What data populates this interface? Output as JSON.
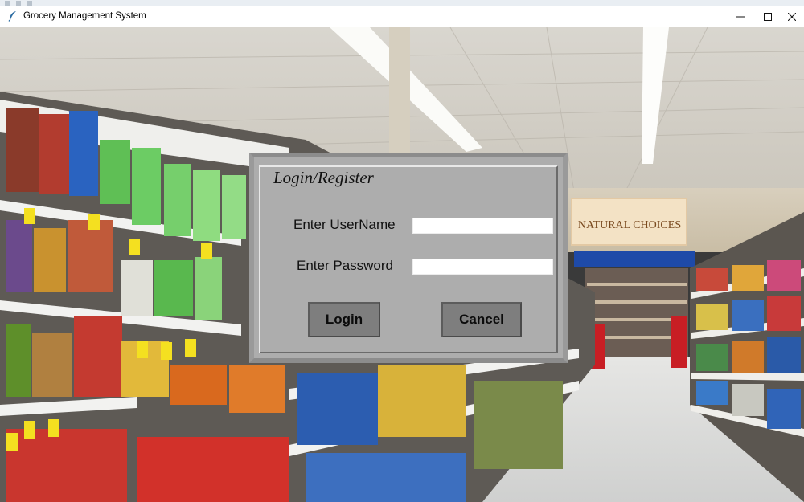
{
  "window": {
    "title": "Grocery Management System",
    "icons": [
      "feather-app-icon",
      "minimize-icon",
      "maximize-icon",
      "close-icon"
    ]
  },
  "store_sign": {
    "text": "NATURAL CHOICES"
  },
  "login": {
    "legend": "Login/Register",
    "username_label": "Enter UserName",
    "username_value": "",
    "password_label": "Enter Password",
    "password_value": "",
    "login_label": "Login",
    "cancel_label": "Cancel"
  },
  "colors": {
    "frame_bg": "#adadad",
    "button_bg": "#7e7e7e"
  }
}
